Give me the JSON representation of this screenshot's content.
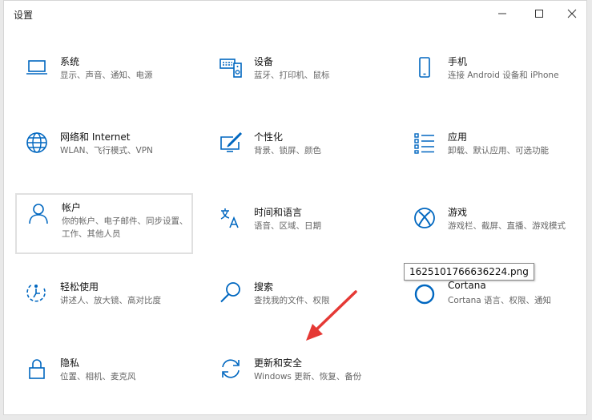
{
  "window": {
    "title": "设置"
  },
  "tiles": [
    {
      "name": "系统",
      "desc": "显示、声音、通知、电源"
    },
    {
      "name": "设备",
      "desc": "蓝牙、打印机、鼠标"
    },
    {
      "name": "手机",
      "desc": "连接 Android 设备和 iPhone"
    },
    {
      "name": "网络和 Internet",
      "desc": "WLAN、飞行模式、VPN"
    },
    {
      "name": "个性化",
      "desc": "背景、锁屏、颜色"
    },
    {
      "name": "应用",
      "desc": "卸载、默认应用、可选功能"
    },
    {
      "name": "帐户",
      "desc": "你的帐户、电子邮件、同步设置、工作、其他人员"
    },
    {
      "name": "时间和语言",
      "desc": "语音、区域、日期"
    },
    {
      "name": "游戏",
      "desc": "游戏栏、截屏、直播、游戏模式"
    },
    {
      "name": "轻松使用",
      "desc": "讲述人、放大镜、高对比度"
    },
    {
      "name": "搜索",
      "desc": "查找我的文件、权限"
    },
    {
      "name": "Cortana",
      "desc": "Cortana 语言、权限、通知"
    },
    {
      "name": "隐私",
      "desc": "位置、相机、麦克风"
    },
    {
      "name": "更新和安全",
      "desc": "Windows 更新、恢复、备份"
    }
  ],
  "tooltip": "1625101766636224.png",
  "colors": {
    "accent": "#0067c0",
    "annotation": "#e53935"
  }
}
